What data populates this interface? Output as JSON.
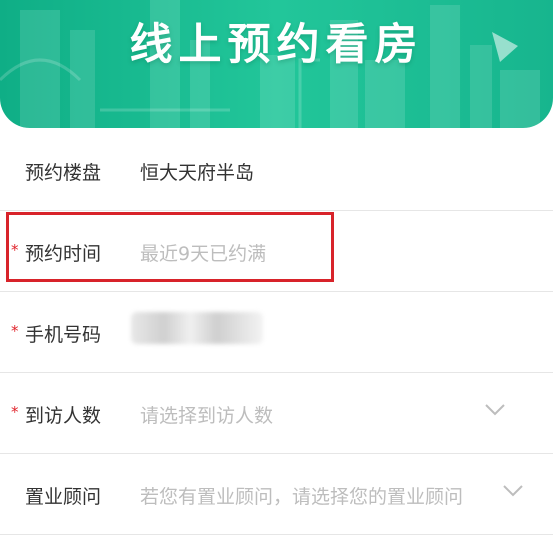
{
  "banner": {
    "title": "线上预约看房"
  },
  "form": {
    "rows": [
      {
        "label": "预约楼盘",
        "value": "恒大天府半岛",
        "required": false
      },
      {
        "label": "预约时间",
        "placeholder": "最近9天已约满",
        "required": true
      },
      {
        "label": "手机号码",
        "value": "",
        "required": true
      },
      {
        "label": "到访人数",
        "placeholder": "请选择到访人数",
        "required": true
      },
      {
        "label": "置业顾问",
        "placeholder": "若您有置业顾问，请选择您的置业顾问",
        "required": false
      }
    ],
    "required_mark": "*"
  },
  "colors": {
    "accent": "#1dbf92",
    "required": "#e0252c",
    "highlight": "#d8232a"
  }
}
